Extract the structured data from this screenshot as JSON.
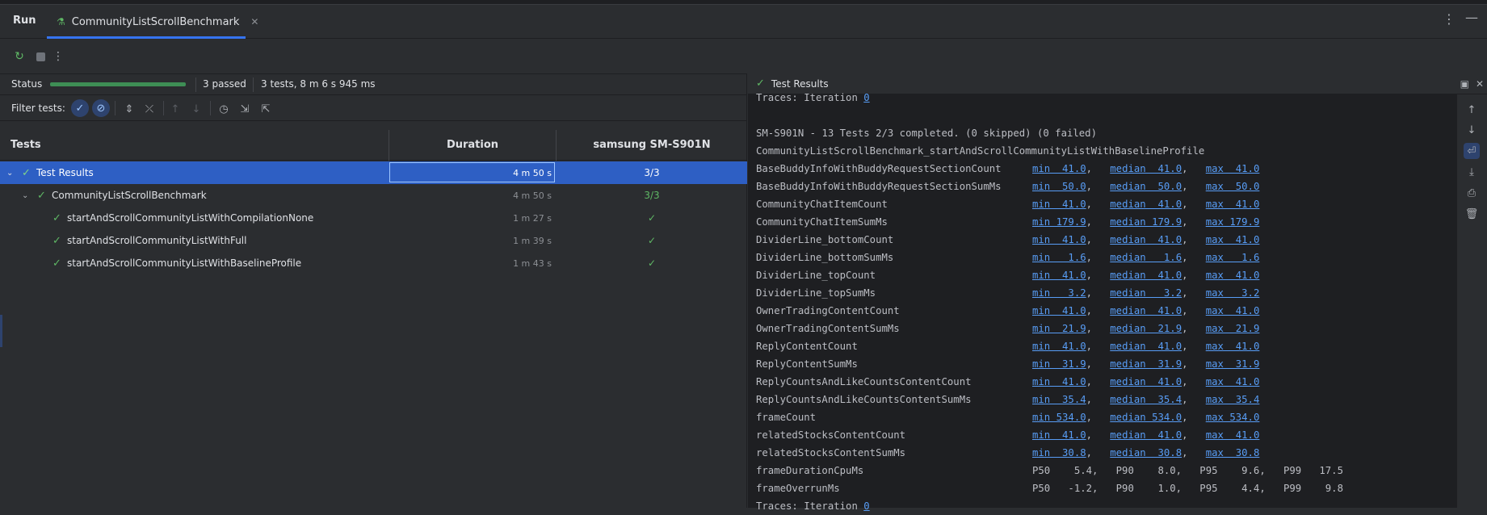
{
  "window": {
    "run_label": "Run",
    "tab_title": "CommunityListScrollBenchmark"
  },
  "status": {
    "label": "Status",
    "progress_fraction": 1.0,
    "passed": "3 passed",
    "summary": "3 tests, 8 m 6 s 945 ms"
  },
  "filter": {
    "label": "Filter tests:"
  },
  "columns": {
    "tests": "Tests",
    "duration": "Duration",
    "device": "samsung SM-S901N"
  },
  "tree": [
    {
      "name": "Test Results",
      "duration": "4 m 50 s",
      "device_result": "3/3",
      "level": 0,
      "selected": true
    },
    {
      "name": "CommunityListScrollBenchmark",
      "duration": "4 m 50 s",
      "device_result": "3/3",
      "level": 1,
      "selected": false
    },
    {
      "name": "startAndScrollCommunityListWithCompilationNone",
      "duration": "1 m 27 s",
      "device_result": "✓",
      "level": 2,
      "selected": false
    },
    {
      "name": "startAndScrollCommunityListWithFull",
      "duration": "1 m 39 s",
      "device_result": "✓",
      "level": 2,
      "selected": false
    },
    {
      "name": "startAndScrollCommunityListWithBaselineProfile",
      "duration": "1 m 43 s",
      "device_result": "✓",
      "level": 2,
      "selected": false
    }
  ],
  "results_panel": {
    "title": "Test Results"
  },
  "console": {
    "traces_top": "Traces: Iteration ",
    "traces_top_link": "0",
    "summary_line": "SM-S901N - 13 Tests 2/3 completed. (0 skipped) (0 failed)",
    "benchmark_name": "CommunityListScrollBenchmark_startAndScrollCommunityListWithBaselineProfile",
    "metrics": [
      {
        "name": "BaseBuddyInfoWithBuddyRequestSectionCount",
        "min": "min  41.0",
        "median": "median  41.0",
        "max": "max  41.0"
      },
      {
        "name": "BaseBuddyInfoWithBuddyRequestSectionSumMs",
        "min": "min  50.0",
        "median": "median  50.0",
        "max": "max  50.0"
      },
      {
        "name": "CommunityChatItemCount",
        "min": "min  41.0",
        "median": "median  41.0",
        "max": "max  41.0"
      },
      {
        "name": "CommunityChatItemSumMs",
        "min": "min 179.9",
        "median": "median 179.9",
        "max": "max 179.9"
      },
      {
        "name": "DividerLine_bottomCount",
        "min": "min  41.0",
        "median": "median  41.0",
        "max": "max  41.0"
      },
      {
        "name": "DividerLine_bottomSumMs",
        "min": "min   1.6",
        "median": "median   1.6",
        "max": "max   1.6"
      },
      {
        "name": "DividerLine_topCount",
        "min": "min  41.0",
        "median": "median  41.0",
        "max": "max  41.0"
      },
      {
        "name": "DividerLine_topSumMs",
        "min": "min   3.2",
        "median": "median   3.2",
        "max": "max   3.2"
      },
      {
        "name": "OwnerTradingContentCount",
        "min": "min  41.0",
        "median": "median  41.0",
        "max": "max  41.0"
      },
      {
        "name": "OwnerTradingContentSumMs",
        "min": "min  21.9",
        "median": "median  21.9",
        "max": "max  21.9"
      },
      {
        "name": "ReplyContentCount",
        "min": "min  41.0",
        "median": "median  41.0",
        "max": "max  41.0"
      },
      {
        "name": "ReplyContentSumMs",
        "min": "min  31.9",
        "median": "median  31.9",
        "max": "max  31.9"
      },
      {
        "name": "ReplyCountsAndLikeCountsContentCount",
        "min": "min  41.0",
        "median": "median  41.0",
        "max": "max  41.0"
      },
      {
        "name": "ReplyCountsAndLikeCountsContentSumMs",
        "min": "min  35.4",
        "median": "median  35.4",
        "max": "max  35.4"
      },
      {
        "name": "frameCount",
        "min": "min 534.0",
        "median": "median 534.0",
        "max": "max 534.0"
      },
      {
        "name": "relatedStocksContentCount",
        "min": "min  41.0",
        "median": "median  41.0",
        "max": "max  41.0"
      },
      {
        "name": "relatedStocksContentSumMs",
        "min": "min  30.8",
        "median": "median  30.8",
        "max": "max  30.8"
      }
    ],
    "percentiles": [
      {
        "name": "frameDurationCpuMs",
        "values": "P50    5.4,   P90    8.0,   P95    9.6,   P99   17.5"
      },
      {
        "name": "frameOverrunMs",
        "values": "P50   -1.2,   P90    1.0,   P95    4.4,   P99    9.8"
      }
    ],
    "traces_bottom": "Traces: Iteration ",
    "traces_bottom_link": "0"
  }
}
